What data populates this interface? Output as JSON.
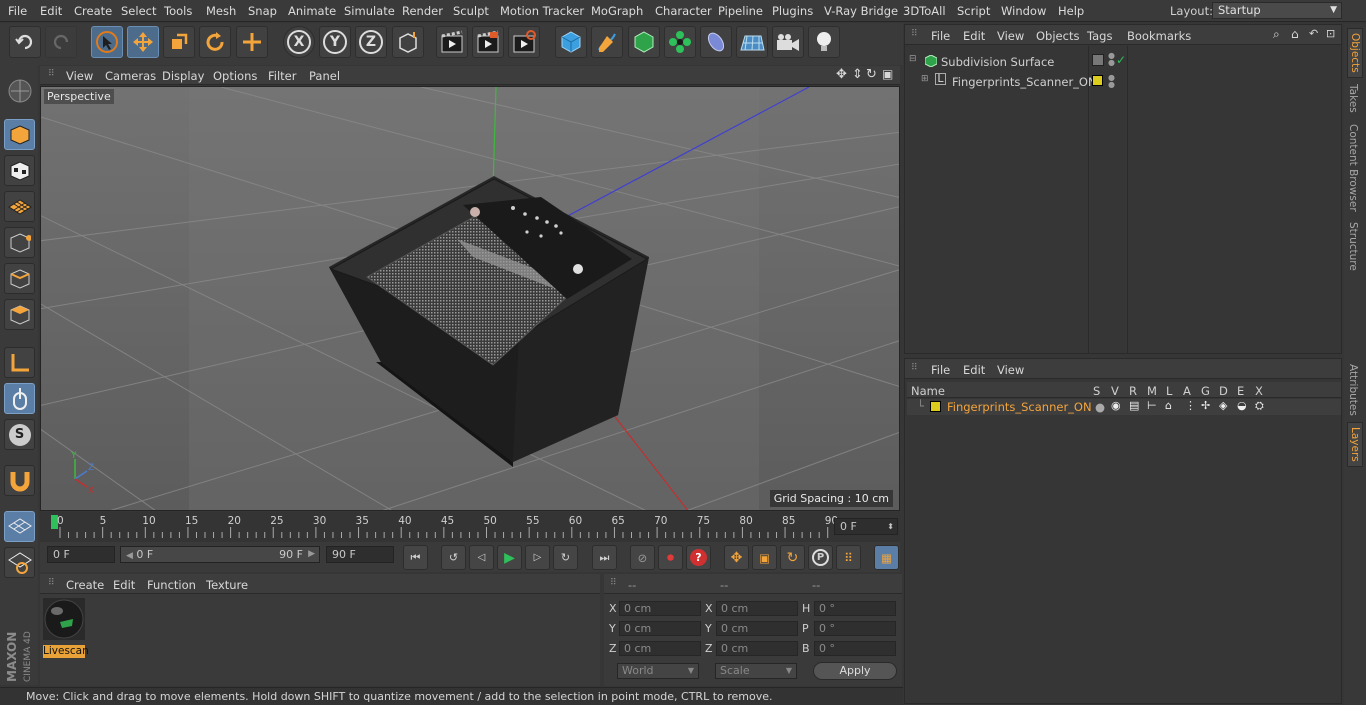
{
  "menu": [
    "File",
    "Edit",
    "Create",
    "Select",
    "Tools",
    "Mesh",
    "Snap",
    "Animate",
    "Simulate",
    "Render",
    "Sculpt",
    "Motion Tracker",
    "MoGraph",
    "Character",
    "Pipeline",
    "Plugins",
    "V-Ray Bridge",
    "3DToAll",
    "Script",
    "Window",
    "Help"
  ],
  "layout": {
    "label": "Layout:",
    "value": "Startup"
  },
  "viewport": {
    "menu": [
      "View",
      "Cameras",
      "Display",
      "Options",
      "Filter",
      "Panel"
    ],
    "label": "Perspective",
    "grid_spacing": "Grid Spacing : 10 cm"
  },
  "timeline": {
    "ticks": [
      "0",
      "5",
      "10",
      "15",
      "20",
      "25",
      "30",
      "35",
      "40",
      "45",
      "50",
      "55",
      "60",
      "65",
      "70",
      "75",
      "80",
      "85",
      "90"
    ],
    "current_frame": "0 F",
    "start": "0 F",
    "range_start": "0 F",
    "range_end": "90 F",
    "end": "90 F"
  },
  "material_panel": {
    "menu": [
      "Create",
      "Edit",
      "Function",
      "Texture"
    ],
    "material_name": "Livescan"
  },
  "coords": {
    "header": [
      "--",
      "--",
      "--"
    ],
    "col1": [
      {
        "axis": "X",
        "value": "0 cm"
      },
      {
        "axis": "Y",
        "value": "0 cm"
      },
      {
        "axis": "Z",
        "value": "0 cm"
      }
    ],
    "col2": [
      {
        "axis": "X",
        "value": "0 cm"
      },
      {
        "axis": "Y",
        "value": "0 cm"
      },
      {
        "axis": "Z",
        "value": "0 cm"
      }
    ],
    "col3": [
      {
        "axis": "H",
        "value": "0 °"
      },
      {
        "axis": "P",
        "value": "0 °"
      },
      {
        "axis": "B",
        "value": "0 °"
      }
    ],
    "world": "World",
    "scale": "Scale",
    "apply": "Apply"
  },
  "status": "Move: Click and drag to move elements. Hold down SHIFT to quantize movement / add to the selection in point mode, CTRL to remove.",
  "objects_panel": {
    "menu": [
      "File",
      "Edit",
      "View",
      "Objects",
      "Tags",
      "Bookmarks"
    ],
    "items": [
      {
        "name": "Subdivision Surface"
      },
      {
        "name": "Fingerprints_Scanner_ON"
      }
    ]
  },
  "layers_panel": {
    "menu": [
      "File",
      "Edit",
      "View"
    ],
    "columns": [
      "Name",
      "S",
      "V",
      "R",
      "M",
      "L",
      "A",
      "G",
      "D",
      "E",
      "X"
    ],
    "rows": [
      {
        "name": "Fingerprints_Scanner_ON",
        "color": "#dccc1e"
      }
    ]
  },
  "right_tabs": [
    "Objects",
    "Takes",
    "Content Browser",
    "Structure",
    "Attributes",
    "Layers"
  ],
  "brand": {
    "maxon": "MAXON",
    "product": "CINEMA 4D"
  },
  "colors": {
    "accent_orange": "#f3a43b",
    "selection_blue": "#5a7ea6",
    "layer_yellow": "#dccc1e"
  }
}
